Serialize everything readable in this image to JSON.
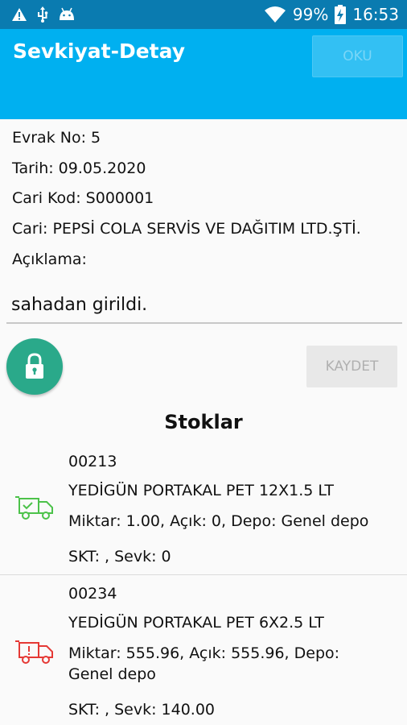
{
  "status_bar": {
    "battery": "99%",
    "time": "16:53",
    "icons": [
      "warning-icon",
      "usb-icon",
      "android-icon",
      "wifi-icon",
      "battery-charging-icon"
    ]
  },
  "app_bar": {
    "title": "Sevkiyat-Detay",
    "oku_label": "OKU",
    "color": "#00b0f0"
  },
  "document": {
    "evrak_no": "Evrak No: 5",
    "tarih": "Tarih: 09.05.2020",
    "cari_kod": "Cari Kod: S000001",
    "cari": "Cari: PEPSİ COLA SERVİS VE DAĞITIM LTD.ŞTİ.",
    "aciklama_label": "Açıklama:",
    "aciklama_value": "sahadan girildi."
  },
  "actions": {
    "lock_icon": "lock-icon",
    "kaydet_label": "KAYDET"
  },
  "stocks": {
    "title": "Stoklar",
    "items": [
      {
        "code": "00213",
        "name": "YEDİGÜN PORTAKAL PET 12X1.5 LT",
        "qty": "Miktar: 1.00, Açık: 0, Depo: Genel depo",
        "skt": "SKT: , Sevk: 0",
        "truck_color": "#4cc24a"
      },
      {
        "code": "00234",
        "name": "YEDİGÜN PORTAKAL PET 6X2.5 LT",
        "qty_line1": "Miktar: 555.96, Açık: 555.96, Depo:",
        "qty_line2": "Genel depo",
        "skt": "SKT: , Sevk: 140.00",
        "truck_color": "#e53935"
      }
    ]
  }
}
